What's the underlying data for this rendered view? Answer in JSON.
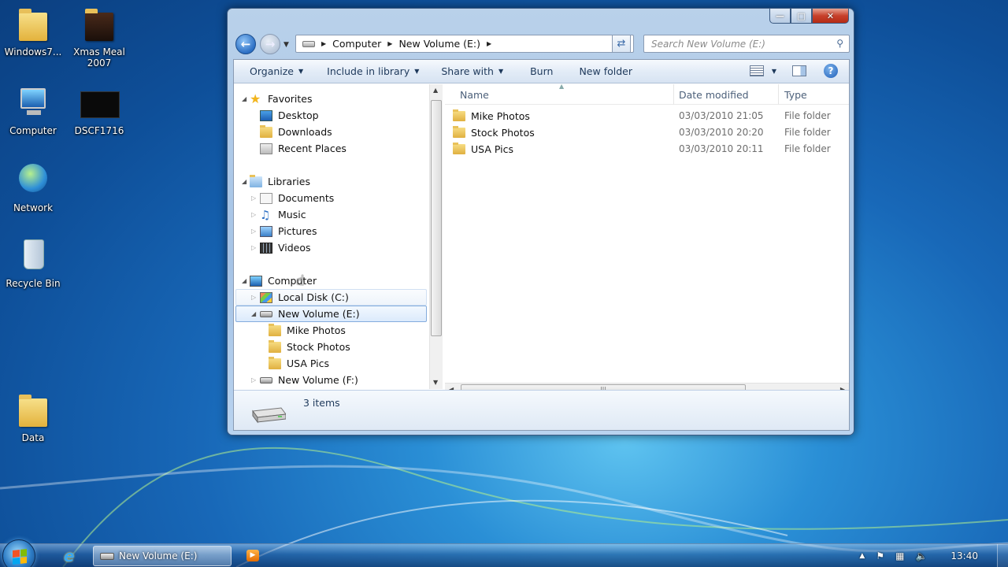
{
  "desktop": {
    "icons": [
      {
        "label": "Windows7..."
      },
      {
        "label": "Xmas Meal 2007"
      },
      {
        "label": "Computer"
      },
      {
        "label": "DSCF1716"
      },
      {
        "label": "Network"
      },
      {
        "label": "Recycle Bin"
      },
      {
        "label": "Data"
      }
    ]
  },
  "window": {
    "address": {
      "segments": [
        "Computer",
        "New Volume (E:)"
      ]
    },
    "search_placeholder": "Search New Volume (E:)",
    "toolbar": {
      "organize": "Organize",
      "include_in_library": "Include in library",
      "share_with": "Share with",
      "burn": "Burn",
      "new_folder": "New folder"
    },
    "nav_tree": {
      "favorites": {
        "label": "Favorites",
        "items": [
          "Desktop",
          "Downloads",
          "Recent Places"
        ]
      },
      "libraries": {
        "label": "Libraries",
        "items": [
          "Documents",
          "Music",
          "Pictures",
          "Videos"
        ]
      },
      "computer": {
        "label": "Computer",
        "drives": [
          "Local Disk (C:)",
          "New Volume (E:)",
          "New Volume (F:)"
        ],
        "e_children": [
          "Mike Photos",
          "Stock Photos",
          "USA Pics"
        ]
      }
    },
    "columns": {
      "name": "Name",
      "date_modified": "Date modified",
      "type": "Type"
    },
    "files": [
      {
        "name": "Mike Photos",
        "date": "03/03/2010 21:05",
        "type": "File folder"
      },
      {
        "name": "Stock Photos",
        "date": "03/03/2010 20:20",
        "type": "File folder"
      },
      {
        "name": "USA Pics",
        "date": "03/03/2010 20:11",
        "type": "File folder"
      }
    ],
    "status": {
      "count": "3 items"
    },
    "selected_drive": "New Volume (E:)"
  },
  "taskbar": {
    "active_window": "New Volume (E:)",
    "clock": "13:40"
  },
  "icons": {
    "back": "back-arrow-icon",
    "forward": "forward-arrow-icon",
    "refresh": "refresh-icon",
    "search": "search-icon",
    "help": "help-icon",
    "views": "views-icon",
    "preview_pane": "preview-pane-icon"
  }
}
